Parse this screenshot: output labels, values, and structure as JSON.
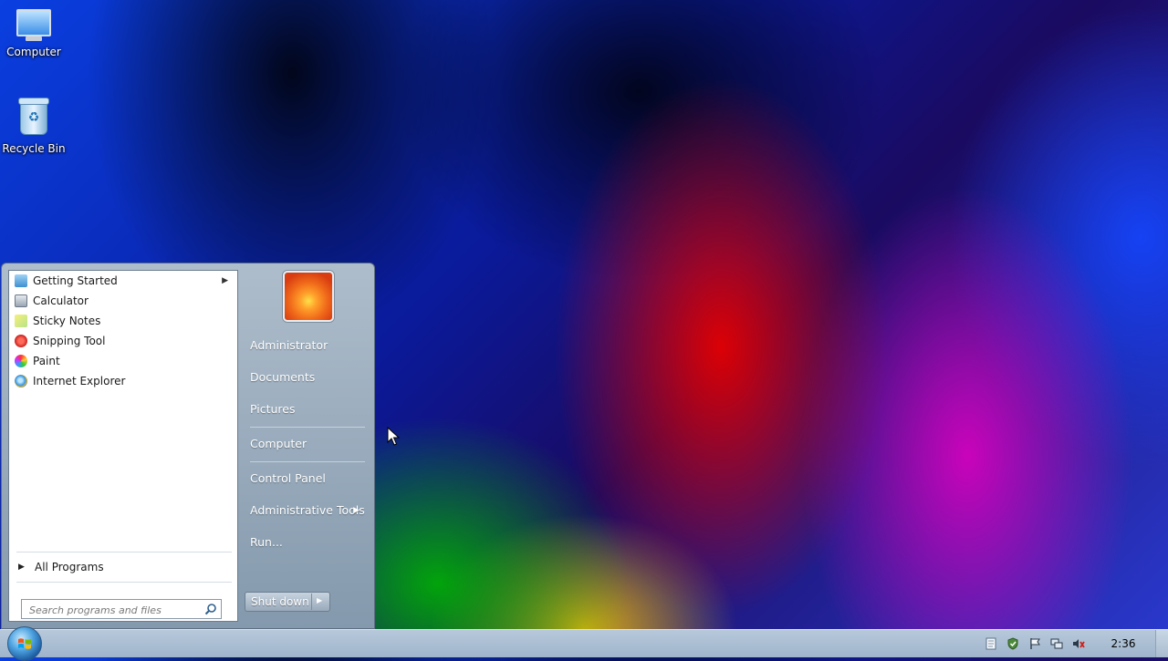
{
  "desktop": {
    "icons": [
      {
        "label": "Computer",
        "icon": "computer-icon"
      },
      {
        "label": "Recycle Bin",
        "icon": "recycle-bin-icon"
      }
    ]
  },
  "start_menu": {
    "programs": [
      {
        "label": "Getting Started",
        "icon": "getting-started-icon",
        "has_submenu": true
      },
      {
        "label": "Calculator",
        "icon": "calculator-icon"
      },
      {
        "label": "Sticky Notes",
        "icon": "sticky-notes-icon"
      },
      {
        "label": "Snipping Tool",
        "icon": "snipping-tool-icon"
      },
      {
        "label": "Paint",
        "icon": "paint-icon"
      },
      {
        "label": "Internet Explorer",
        "icon": "internet-explorer-icon"
      }
    ],
    "all_programs": "All Programs",
    "search_placeholder": "Search programs and files",
    "right_items": [
      {
        "label": "Administrator"
      },
      {
        "label": "Documents"
      },
      {
        "label": "Pictures"
      },
      {
        "label": "Computer"
      },
      {
        "label": "Control Panel"
      },
      {
        "label": "Administrative Tools",
        "has_submenu": true
      },
      {
        "label": "Run..."
      }
    ],
    "shutdown_label": "Shut down"
  },
  "taskbar": {
    "clock": "2:36",
    "tray_icons": [
      "document-icon",
      "security-shield-icon",
      "action-center-flag-icon",
      "network-icon",
      "volume-muted-icon"
    ]
  }
}
